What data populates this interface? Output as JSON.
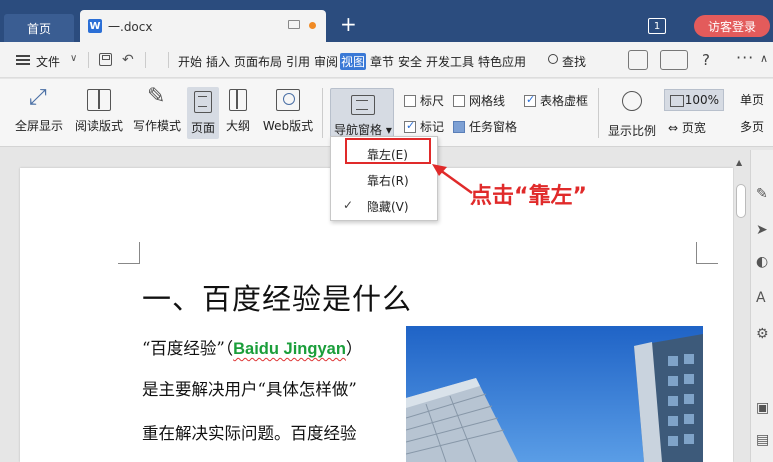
{
  "titlebar": {
    "home_tab": "首页",
    "doc_tab": "一.docx",
    "doc_logo": "W",
    "new_tab_symbol": "+",
    "window_count": "1",
    "visitor_login": "访客登录"
  },
  "menubar": {
    "file": "文件",
    "items": [
      "开始",
      "插入",
      "页面布局",
      "引用",
      "审阅",
      "视图",
      "章节",
      "安全",
      "开发工具",
      "特色应用"
    ],
    "active_item": "视图",
    "find": "查找",
    "help": "?"
  },
  "ribbon": {
    "buttons": [
      "全屏显示",
      "阅读版式",
      "写作模式",
      "页面",
      "大纲",
      "Web版式"
    ],
    "selected_button": "页面",
    "nav_pane": "导航窗格",
    "checkboxes": [
      {
        "label": "标尺",
        "checked": false
      },
      {
        "label": "网格线",
        "checked": false
      },
      {
        "label": "表格虚框",
        "checked": true
      },
      {
        "label": "标记",
        "checked": true
      },
      {
        "label": "任务窗格",
        "checked": false
      }
    ],
    "zoom_label": "显示比例",
    "zoom_value": "100%",
    "page_width": "页宽",
    "single_page": "单页",
    "multi_page": "多页"
  },
  "dropdown": {
    "items": [
      "靠左(E)",
      "靠右(R)",
      "隐藏(V)"
    ],
    "checked_item": "隐藏(V)"
  },
  "annotation": {
    "callout_text": "点击“靠左”",
    "highlight_color": "#e02a2a"
  },
  "document": {
    "heading": "一、百度经验是什么",
    "line1_prefix": "“百度经验”（",
    "line1_brand": "Baidu Jingyan",
    "line1_suffix": "）",
    "line2": "是主要解决用户“具体怎样做”",
    "line3": "重在解决实际问题。百度经验"
  },
  "colors": {
    "titlebar": "#2b4c7e",
    "accent": "#3a79d6",
    "brand_green": "#1a9e3a",
    "login_button": "#e35b5b"
  }
}
